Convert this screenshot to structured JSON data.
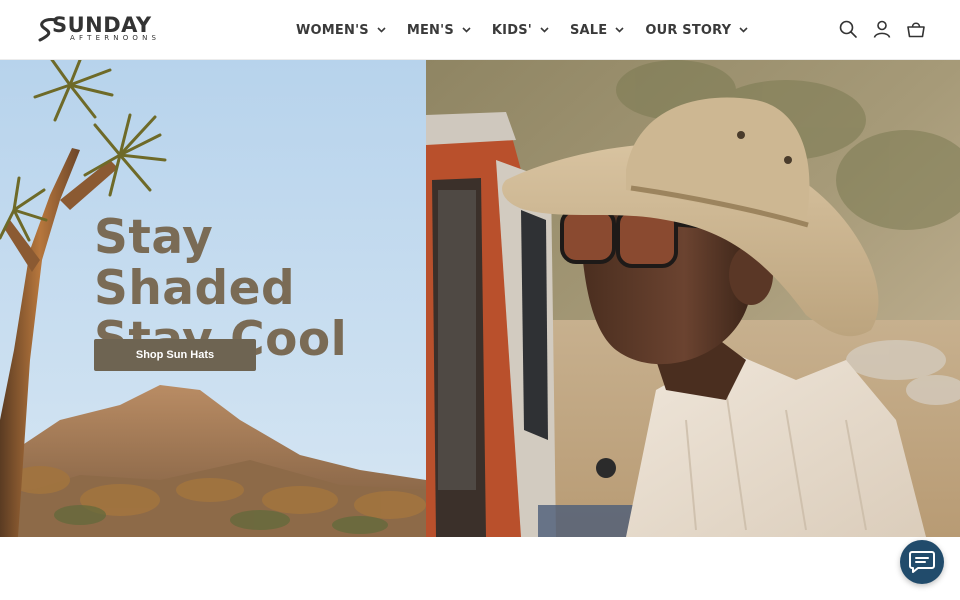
{
  "brand": {
    "name": "SUNDAY",
    "tagline": "AFTERNOONS"
  },
  "nav": {
    "items": [
      {
        "label": "WOMEN'S"
      },
      {
        "label": "MEN'S"
      },
      {
        "label": "KIDS'"
      },
      {
        "label": "SALE"
      },
      {
        "label": "OUR STORY"
      }
    ]
  },
  "header_icons": [
    "search-icon",
    "account-icon",
    "cart-icon"
  ],
  "hero": {
    "heading_line1": "Stay Shaded",
    "heading_line2": "Stay Cool",
    "cta_label": "Shop Sun Hats"
  },
  "chat": {
    "icon": "chat-icon"
  },
  "colors": {
    "heading": "#7a6b55",
    "cta_background": "#6e6452",
    "chat_background": "#214b6b",
    "sky": "#b9d6ee"
  }
}
